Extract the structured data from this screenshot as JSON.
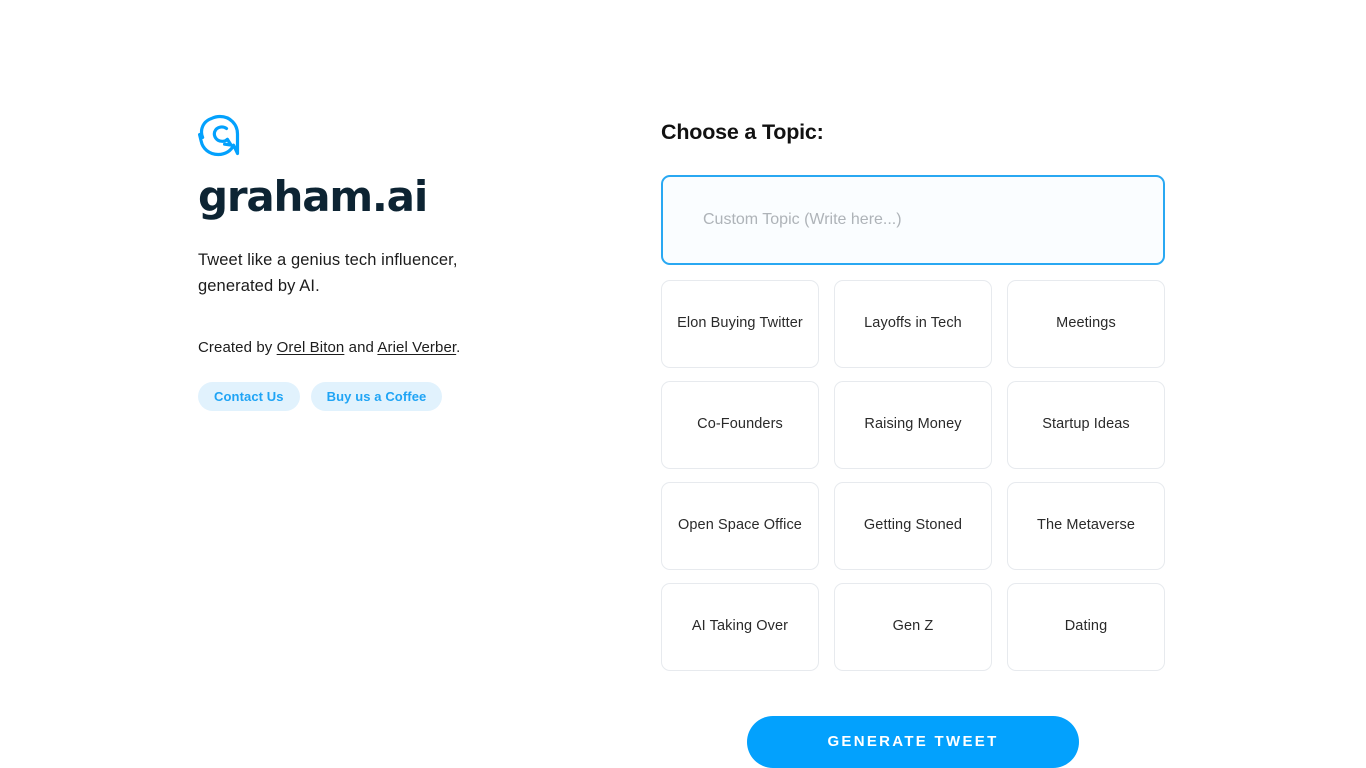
{
  "brand": {
    "logo_icon": "bird-icon",
    "wordmark": "graham.ai",
    "tagline": "Tweet like a genius tech influencer, generated by AI.",
    "accent_color": "#03a1fd",
    "wordmark_color": "#0d2433"
  },
  "credits": {
    "prefix": "Created by ",
    "author_one": "Orel Biton",
    "conjunction": " and ",
    "author_two": "Ariel Verber",
    "suffix": "."
  },
  "actions": {
    "contact_label": "Contact Us",
    "coffee_label": "Buy us a Coffee",
    "pill_bg": "#e1f2fd",
    "pill_text_color": "#1fa4f5"
  },
  "panel": {
    "title": "Choose a Topic:",
    "custom_topic": {
      "value": "",
      "placeholder": "Custom Topic (Write here...)",
      "border_color": "#29a8f2"
    },
    "topics": [
      {
        "label": "Elon Buying Twitter"
      },
      {
        "label": "Layoffs in Tech"
      },
      {
        "label": "Meetings"
      },
      {
        "label": "Co-Founders"
      },
      {
        "label": "Raising Money"
      },
      {
        "label": "Startup Ideas"
      },
      {
        "label": "Open Space Office"
      },
      {
        "label": "Getting Stoned"
      },
      {
        "label": "The Metaverse"
      },
      {
        "label": "AI Taking Over"
      },
      {
        "label": "Gen Z"
      },
      {
        "label": "Dating"
      }
    ],
    "generate_label": "Generate Tweet"
  }
}
